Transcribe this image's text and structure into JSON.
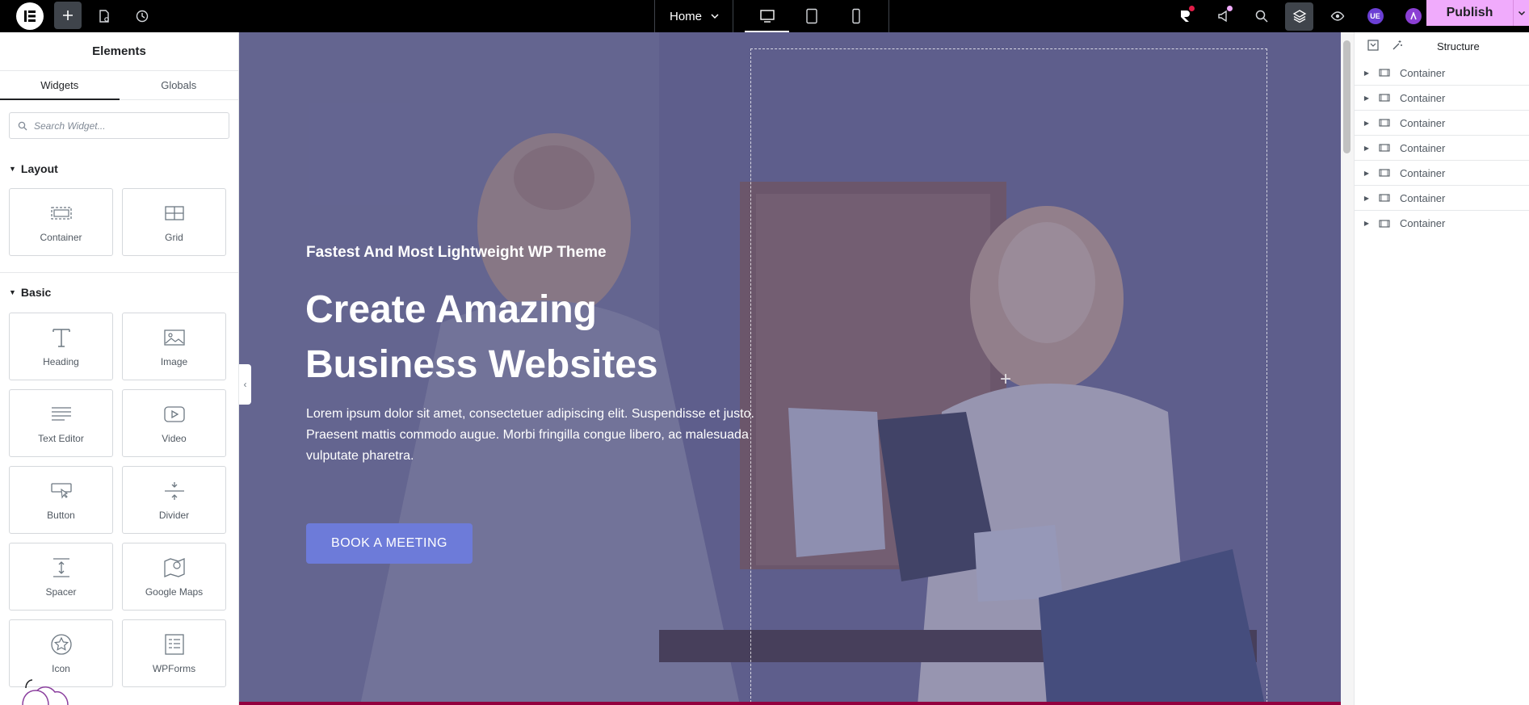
{
  "topbar": {
    "page_name": "Home",
    "avatar_initials": "UE",
    "publish_label": "Publish"
  },
  "panel": {
    "title": "Elements",
    "tabs": [
      {
        "label": "Widgets"
      },
      {
        "label": "Globals"
      }
    ],
    "search_placeholder": "Search Widget...",
    "categories": [
      {
        "label": "Layout",
        "widgets": [
          {
            "label": "Container",
            "icon": "container-icon"
          },
          {
            "label": "Grid",
            "icon": "grid-icon"
          }
        ]
      },
      {
        "label": "Basic",
        "widgets": [
          {
            "label": "Heading",
            "icon": "heading-icon"
          },
          {
            "label": "Image",
            "icon": "image-icon"
          },
          {
            "label": "Text Editor",
            "icon": "text-editor-icon"
          },
          {
            "label": "Video",
            "icon": "video-icon"
          },
          {
            "label": "Button",
            "icon": "button-icon"
          },
          {
            "label": "Divider",
            "icon": "divider-icon"
          },
          {
            "label": "Spacer",
            "icon": "spacer-icon"
          },
          {
            "label": "Google Maps",
            "icon": "map-icon"
          },
          {
            "label": "Icon",
            "icon": "star-icon"
          },
          {
            "label": "WPForms",
            "icon": "form-icon"
          }
        ]
      }
    ]
  },
  "hero": {
    "kicker": "Fastest And Most Lightweight WP Theme",
    "title": "Create Amazing Business Websites",
    "text": "Lorem ipsum dolor sit amet, consectetuer adipiscing elit. Suspendisse et justo. Praesent mattis commodo augue. Morbi fringilla congue libero, ac malesuada vulputate pharetra.",
    "button": "BOOK A MEETING"
  },
  "structure": {
    "title": "Structure",
    "items": [
      {
        "label": "Container"
      },
      {
        "label": "Container"
      },
      {
        "label": "Container"
      },
      {
        "label": "Container"
      },
      {
        "label": "Container"
      },
      {
        "label": "Container"
      },
      {
        "label": "Container"
      }
    ]
  },
  "colors": {
    "accent": "#f0abfc",
    "button": "#6d7bd9",
    "overlay": "#52548c"
  }
}
